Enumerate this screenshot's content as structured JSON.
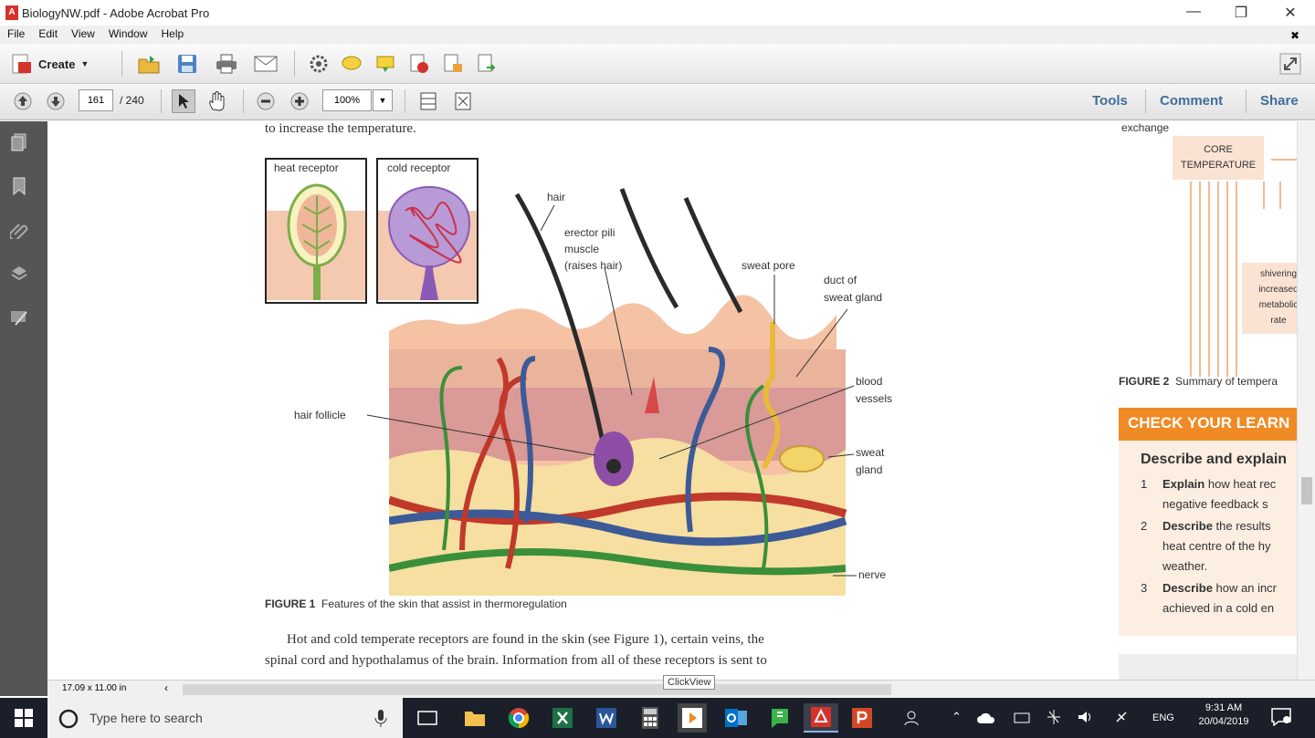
{
  "window": {
    "title": "BiologyNW.pdf - Adobe Acrobat Pro"
  },
  "menu": [
    "File",
    "Edit",
    "View",
    "Window",
    "Help"
  ],
  "toolbar": {
    "create_label": "Create"
  },
  "nav": {
    "page": "161",
    "total": "/ 240",
    "zoom": "100%"
  },
  "right_links": {
    "tools": "Tools",
    "comment": "Comment",
    "share": "Share"
  },
  "page": {
    "top_text": "to increase the temperature.",
    "heat_receptor": "heat receptor",
    "cold_receptor": "cold receptor",
    "labels": {
      "hair": "hair",
      "erector_1": "erector pili",
      "erector_2": "muscle",
      "erector_3": "(raises hair)",
      "sweat_pore": "sweat pore",
      "duct_1": "duct of",
      "duct_2": "sweat gland",
      "blood_1": "blood",
      "blood_2": "vessels",
      "hair_follicle": "hair follicle",
      "sweat_gland_1": "sweat",
      "sweat_gland_2": "gland",
      "nerve": "nerve"
    },
    "caption_num": "FIGURE 1",
    "caption_text": "Features of the skin that assist in thermoregulation",
    "body_line1": "Hot and cold temperate receptors are found in the skin (see Figure 1), certain veins, the",
    "body_line2": "spinal cord and hypothalamus of the brain. Information from all of these receptors is sent to",
    "side_exchange": "exchange",
    "core_1": "CORE",
    "core_2": "TEMPERATURE",
    "shiver": [
      "shivering",
      "increased",
      "metabolic",
      "rate"
    ],
    "fig2_num": "FIGURE 2",
    "fig2_text": "Summary of tempera",
    "check_title": "CHECK YOUR LEARN",
    "describe": "Describe and explain",
    "q1_num": "1",
    "q1_bold": "Explain",
    "q1_text": " how heat rec",
    "q1_line2": "negative feedback s",
    "q2_num": "2",
    "q2_bold": "Describe",
    "q2_text": " the results",
    "q2_line2": "heat centre of the hy",
    "q2_line3": "weather.",
    "q3_num": "3",
    "q3_bold": "Describe",
    "q3_text": " how an incr",
    "q3_line2": "achieved in a cold en"
  },
  "statusbar": {
    "size": "17.09 x 11.00 in",
    "tooltip": "ClickView"
  },
  "taskbar": {
    "search_placeholder": "Type here to search",
    "lang": "ENG",
    "time": "9:31 AM",
    "date": "20/04/2019"
  },
  "colors": {
    "accent_orange": "#f08a24",
    "link_blue": "#3f6d99",
    "taskbar": "#1a1f2a"
  }
}
